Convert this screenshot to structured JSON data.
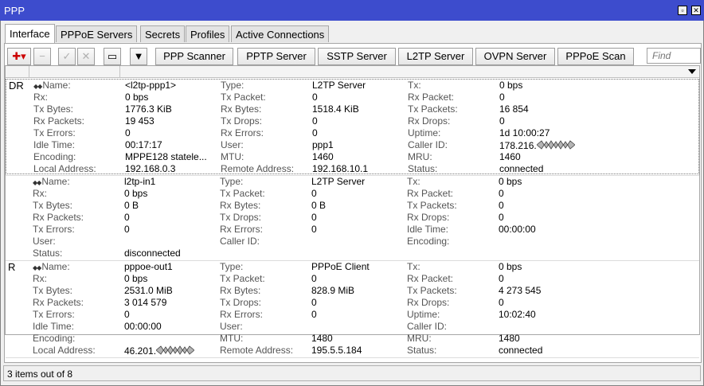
{
  "window": {
    "title": "PPP",
    "restore_icon": "restore-icon",
    "close_icon": "close-icon"
  },
  "tabs": [
    "Interface",
    "PPPoE Servers",
    "Secrets",
    "Profiles",
    "Active Connections"
  ],
  "toolbar": {
    "add": "✚▾",
    "buttons": [
      "PPP Scanner",
      "PPTP Server",
      "SSTP Server",
      "L2TP Server",
      "OVPN Server",
      "PPPoE Scan"
    ],
    "find_placeholder": "Find"
  },
  "records": [
    {
      "flag": "DR",
      "fields": [
        [
          "Name:",
          "<l2tp-ppp1>",
          "Type:",
          "L2TP Server",
          "Tx:",
          "0 bps"
        ],
        [
          "Rx:",
          "0 bps",
          "Tx Packet:",
          "0",
          "Rx Packet:",
          "0"
        ],
        [
          "Tx Bytes:",
          "1776.3 KiB",
          "Rx Bytes:",
          "1518.4 KiB",
          "Tx Packets:",
          "16 854"
        ],
        [
          "Rx Packets:",
          "19 453",
          "Tx Drops:",
          "0",
          "Rx Drops:",
          "0"
        ],
        [
          "Tx Errors:",
          "0",
          "Rx Errors:",
          "0",
          "Uptime:",
          "1d 10:00:27"
        ],
        [
          "Idle Time:",
          "00:17:17",
          "User:",
          "ppp1",
          "Caller ID:",
          "178.216."
        ],
        [
          "Encoding:",
          "MPPE128 statele...",
          "MTU:",
          "1460",
          "MRU:",
          "1460"
        ],
        [
          "Local Address:",
          "192.168.0.3",
          "Remote Address:",
          "192.168.10.1",
          "Status:",
          "connected"
        ]
      ]
    },
    {
      "flag": "",
      "fields": [
        [
          "Name:",
          "l2tp-in1",
          "Type:",
          "L2TP Server",
          "Tx:",
          "0 bps"
        ],
        [
          "Rx:",
          "0 bps",
          "Tx Packet:",
          "0",
          "Rx Packet:",
          "0"
        ],
        [
          "Tx Bytes:",
          "0 B",
          "Rx Bytes:",
          "0 B",
          "Tx Packets:",
          "0"
        ],
        [
          "Rx Packets:",
          "0",
          "Tx Drops:",
          "0",
          "Rx Drops:",
          "0"
        ],
        [
          "Tx Errors:",
          "0",
          "Rx Errors:",
          "0",
          "Idle Time:",
          "00:00:00"
        ],
        [
          "User:",
          "",
          "Caller ID:",
          "",
          "Encoding:",
          ""
        ],
        [
          "Status:",
          "disconnected",
          "",
          "",
          "",
          ""
        ]
      ]
    },
    {
      "flag": "R",
      "fields": [
        [
          "Name:",
          "pppoe-out1",
          "Type:",
          "PPPoE Client",
          "Tx:",
          "0 bps"
        ],
        [
          "Rx:",
          "0 bps",
          "Tx Packet:",
          "0",
          "Rx Packet:",
          "0"
        ],
        [
          "Tx Bytes:",
          "2531.0 MiB",
          "Rx Bytes:",
          "828.9 MiB",
          "Tx Packets:",
          "4 273 545"
        ],
        [
          "Rx Packets:",
          "3 014 579",
          "Tx Drops:",
          "0",
          "Rx Drops:",
          "0"
        ],
        [
          "Tx Errors:",
          "0",
          "Rx Errors:",
          "0",
          "Uptime:",
          "10:02:40"
        ],
        [
          "Idle Time:",
          "00:00:00",
          "User:",
          "",
          "Caller ID:",
          ""
        ],
        [
          "Encoding:",
          "",
          "MTU:",
          "1480",
          "MRU:",
          "1480"
        ],
        [
          "Local Address:",
          "46.201.",
          "Remote Address:",
          "195.5.5.184",
          "Status:",
          "connected"
        ]
      ]
    }
  ],
  "status_bar": "3 items out of 8"
}
